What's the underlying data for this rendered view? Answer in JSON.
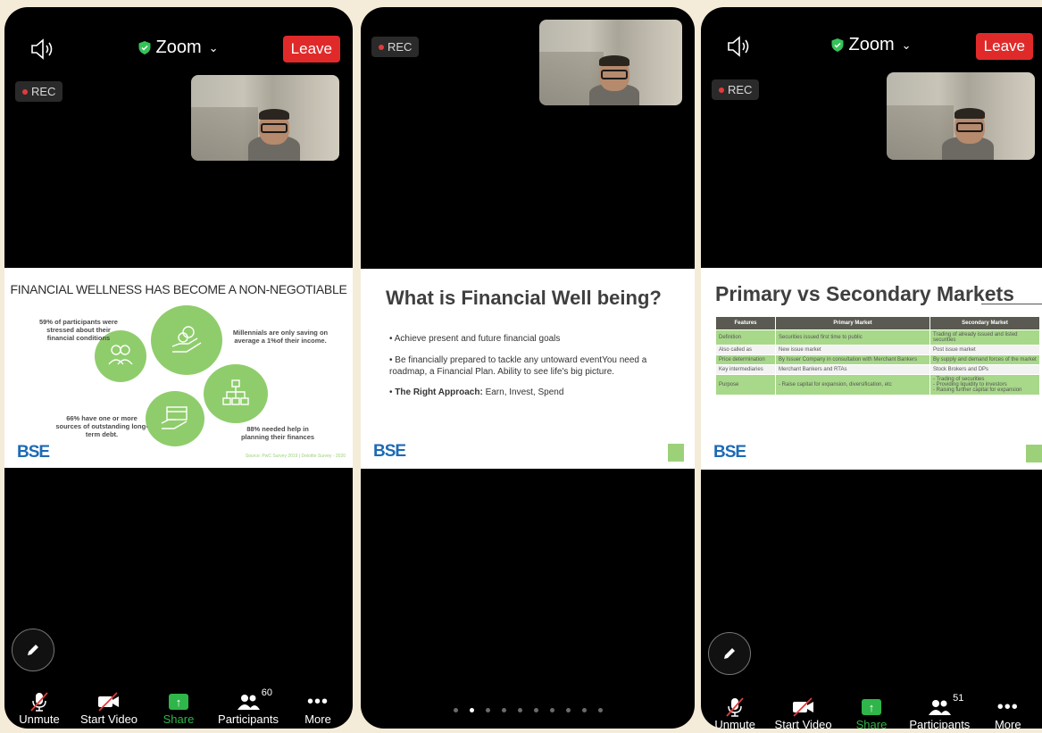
{
  "phone1": {
    "topbar": {
      "title": "Zoom",
      "leave_label": "Leave"
    },
    "rec_label": "REC",
    "slide": {
      "title": "FINANCIAL WELLNESS HAS BECOME A NON-NEGOTIABLE",
      "stats": [
        "59% of participants were stressed about their financial conditions",
        "Millennials are only saving on average a 1%of their income.",
        "66% have one or more sources of outstanding long-term debt.",
        "88% needed help in planning their finances"
      ],
      "source": "Source: PwC Survey 2019 | Deloitte Survey - 2020",
      "logo": "BSE"
    },
    "toolbar": [
      {
        "label": "Unmute",
        "icon": "muted-mic-icon"
      },
      {
        "label": "Start Video",
        "icon": "video-off-icon"
      },
      {
        "label": "Share",
        "icon": "share-icon"
      },
      {
        "label": "Participants",
        "icon": "participants-icon",
        "count": "60"
      },
      {
        "label": "More",
        "icon": "more-icon"
      }
    ]
  },
  "phone2": {
    "rec_label": "REC",
    "slide": {
      "title": "What is Financial Well being?",
      "bullets": [
        "Achieve present and future financial goals",
        "Be financially prepared to tackle any untoward eventYou need a roadmap, a Financial Plan. Ability to see life's big picture."
      ],
      "approach_bold": "The Right Approach:",
      "approach_text": " Earn, Invest, Spend",
      "logo": "BSE"
    },
    "page_dots": 10,
    "active_dot": 1
  },
  "phone3": {
    "topbar": {
      "title": "Zoom",
      "leave_label": "Leave"
    },
    "rec_label": "REC",
    "slide": {
      "title": "Primary vs Secondary Markets",
      "table": {
        "headers": [
          "Features",
          "Primary Market",
          "Secondary Market"
        ],
        "rows": [
          [
            "Definition",
            "Securities issued first time to public",
            "Trading of already issued and listed securities"
          ],
          [
            "Also called as",
            "New issue market",
            "Post issue market"
          ],
          [
            "Price determination",
            "By Issuer Company in consultation with Merchant Bankers",
            "By supply and demand forces of the market"
          ],
          [
            "Key intermediaries",
            "Merchant Bankers and RTAs",
            "Stock Brokers and DPs"
          ],
          [
            "Purpose",
            "- Raise capital for expansion, diversification, etc",
            "- Trading of securities\n- Providing liquidity to investors\n- Raising further capital for expansion"
          ]
        ]
      },
      "logo": "BSE"
    },
    "toolbar": [
      {
        "label": "Unmute",
        "icon": "muted-mic-icon"
      },
      {
        "label": "Start Video",
        "icon": "video-off-icon"
      },
      {
        "label": "Share",
        "icon": "share-icon"
      },
      {
        "label": "Participants",
        "icon": "participants-icon",
        "count": "51"
      },
      {
        "label": "More",
        "icon": "more-icon"
      }
    ]
  },
  "colors": {
    "leave": "#e02a2a",
    "share": "#2fb54a",
    "slide_green": "#8fcd6c",
    "bse_blue": "#1d6ab5"
  }
}
